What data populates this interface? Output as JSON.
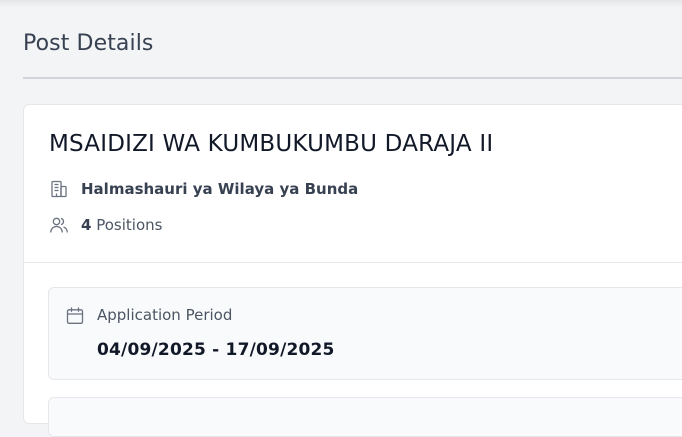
{
  "page": {
    "title": "Post Details"
  },
  "post": {
    "title": "MSAIDIZI WA KUMBUKUMBU DARAJA II",
    "organization": "Halmashauri ya Wilaya ya Bunda",
    "positions_count": "4",
    "positions_label": "Positions"
  },
  "application_period": {
    "label": "Application Period",
    "value": "04/09/2025 - 17/09/2025"
  },
  "icons": {
    "organization": "building-icon",
    "positions": "users-icon",
    "period": "calendar-icon"
  },
  "colors": {
    "background": "#f3f4f6",
    "card": "#ffffff",
    "muted_box": "#f9fafb",
    "text_primary": "#111827",
    "text_secondary": "#4b5563"
  }
}
